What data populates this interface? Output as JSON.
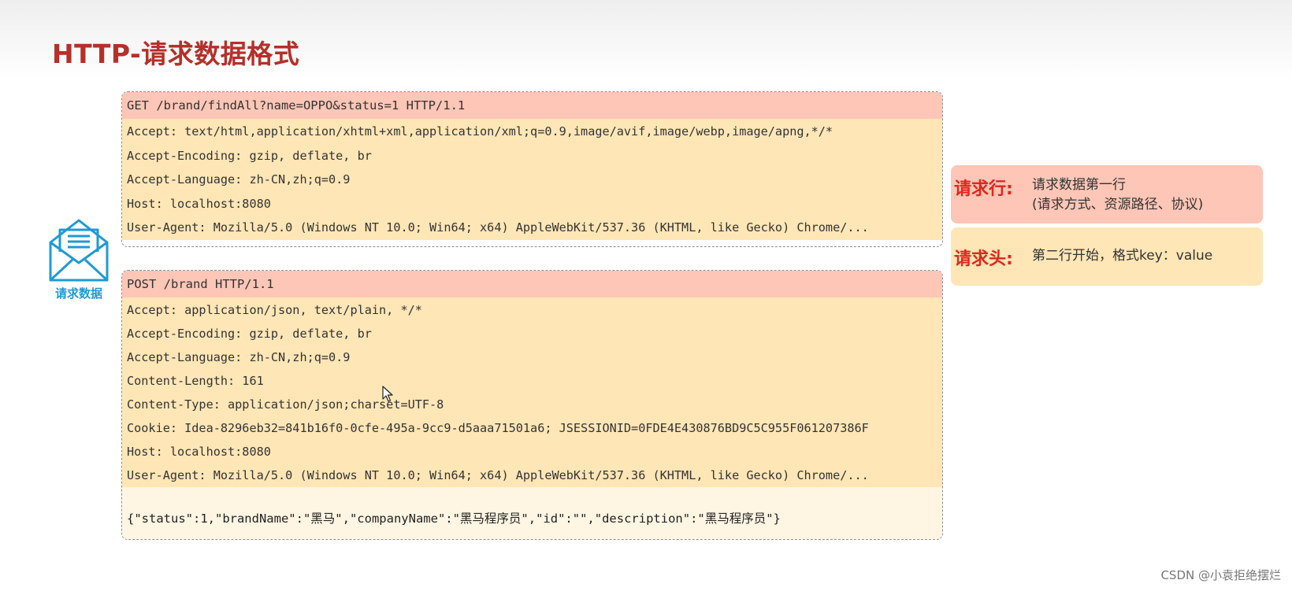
{
  "title": "HTTP-请求数据格式",
  "icon_label": "请求数据",
  "get_request": {
    "request_line": "GET /brand/findAll?name=OPPO&status=1 HTTP/1.1",
    "headers": [
      "Accept: text/html,application/xhtml+xml,application/xml;q=0.9,image/avif,image/webp,image/apng,*/*",
      "Accept-Encoding: gzip, deflate, br",
      "Accept-Language: zh-CN,zh;q=0.9",
      "Host: localhost:8080",
      "User-Agent: Mozilla/5.0 (Windows NT 10.0; Win64; x64) AppleWebKit/537.36 (KHTML, like Gecko) Chrome/..."
    ]
  },
  "post_request": {
    "request_line": "POST /brand HTTP/1.1",
    "headers": [
      "Accept: application/json, text/plain, */*",
      "Accept-Encoding: gzip, deflate, br",
      "Accept-Language: zh-CN,zh;q=0.9",
      "Content-Length: 161",
      "Content-Type: application/json;charset=UTF-8",
      "Cookie: Idea-8296eb32=841b16f0-0cfe-495a-9cc9-d5aaa71501a6; JSESSIONID=0FDE4E430876BD9C5C955F061207386F",
      "Host: localhost:8080",
      "User-Agent: Mozilla/5.0 (Windows NT 10.0; Win64; x64) AppleWebKit/537.36 (KHTML, like Gecko) Chrome/..."
    ],
    "body": "{\"status\":1,\"brandName\":\"黑马\",\"companyName\":\"黑马程序员\",\"id\":\"\",\"description\":\"黑马程序员\"}"
  },
  "legend": {
    "request_line_key": "请求行:",
    "request_line_desc_1": "请求数据第一行",
    "request_line_desc_2": "(请求方式、资源路径、协议)",
    "request_header_key": "请求头:",
    "request_header_desc": "第二行开始，格式key：value"
  },
  "watermark": "CSDN @小袁拒绝摆烂",
  "colors": {
    "title": "#b5302a",
    "request_line_bg": "#fdc6b6",
    "header_bg": "#fee6b6",
    "body_bg": "#fff5e3",
    "legend_key": "#e2261d",
    "icon": "#1f9ad6"
  },
  "icons": {
    "request_data": "envelope-document-icon",
    "cursor": "mouse-cursor-icon"
  }
}
